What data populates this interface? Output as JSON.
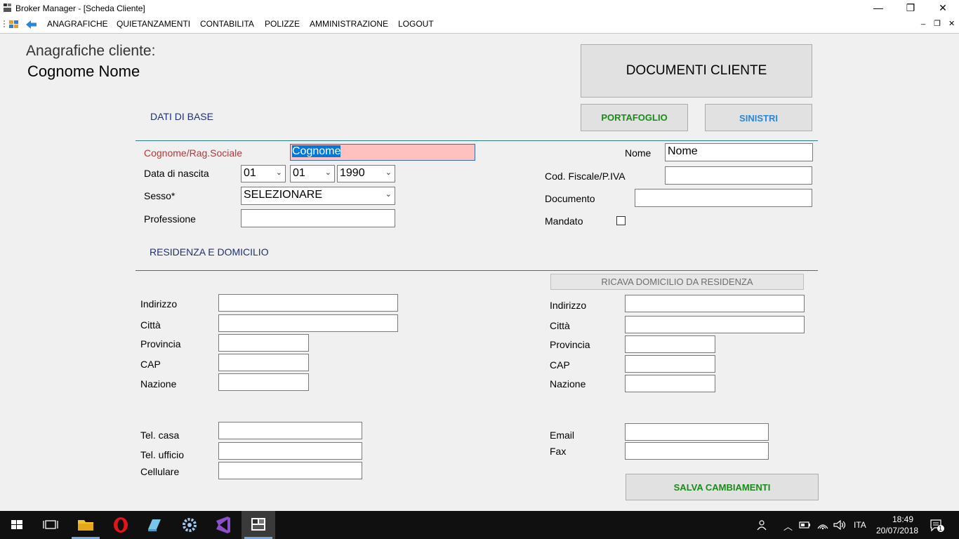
{
  "window": {
    "title": "Broker Manager - [Scheda Cliente]",
    "minimize_glyph": "—",
    "restore_glyph": "❐",
    "close_glyph": "✕"
  },
  "menu": {
    "items": [
      "ANAGRAFICHE",
      "QUIETANZAMENTI",
      "CONTABILITA",
      "POLIZZE",
      "AMMINISTRAZIONE",
      "LOGOUT"
    ],
    "mdi_min": "_",
    "mdi_restore": "❐",
    "mdi_close": "✕"
  },
  "header": {
    "title": "Anagrafiche cliente:",
    "name": "Cognome Nome"
  },
  "buttons": {
    "documenti": "DOCUMENTI CLIENTE",
    "portafoglio": "PORTAFOGLIO",
    "sinistri": "SINISTRI",
    "ricava": "RICAVA DOMICILIO DA RESIDENZA",
    "salva": "SALVA CAMBIAMENTI"
  },
  "sections": {
    "base": "DATI DI BASE",
    "residenza": "RESIDENZA E DOMICILIO"
  },
  "base": {
    "cognome_label": "Cognome/Rag.Sociale",
    "cognome_value": "Cognome",
    "nome_label": "Nome",
    "nome_value": "Nome",
    "nascita_label": "Data di nascita",
    "day": "01",
    "month": "01",
    "year": "1990",
    "codfisc_label": "Cod. Fiscale/P.IVA",
    "sesso_label": "Sesso*",
    "sesso_value": "SELEZIONARE",
    "documento_label": "Documento",
    "professione_label": "Professione",
    "mandato_label": "Mandato"
  },
  "residenza": {
    "indirizzo": "Indirizzo",
    "citta": "Città",
    "provincia": "Provincia",
    "cap": "CAP",
    "nazione": "Nazione"
  },
  "contacts": {
    "tel_casa": "Tel. casa",
    "tel_ufficio": "Tel. ufficio",
    "cellulare": "Cellulare",
    "email": "Email",
    "fax": "Fax"
  },
  "taskbar": {
    "language": "ITA",
    "time": "18:49",
    "date": "20/07/2018",
    "notification_count": "1"
  },
  "colors": {
    "accent_red_label": "#b23a3a",
    "section_blue": "#1f2f7a",
    "divider": "#2a7a8c",
    "green_button_text": "#1a8a1a",
    "blue_button_text": "#2b86d6",
    "pink_field": "#ffc0c0"
  }
}
